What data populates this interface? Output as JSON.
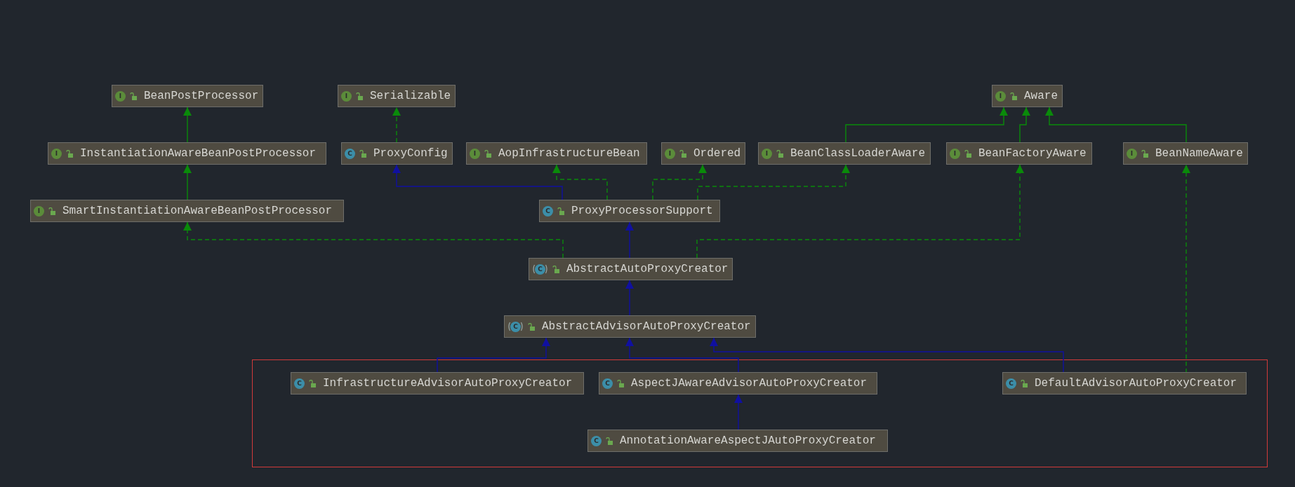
{
  "diagram": {
    "nodes": [
      {
        "name": "BeanPostProcessor",
        "kind": "interface",
        "icon_letter": "I"
      },
      {
        "name": "Serializable",
        "kind": "interface",
        "icon_letter": "I"
      },
      {
        "name": "Aware",
        "kind": "interface",
        "icon_letter": "I"
      },
      {
        "name": "InstantiationAwareBeanPostProcessor",
        "kind": "interface",
        "icon_letter": "I"
      },
      {
        "name": "ProxyConfig",
        "kind": "class",
        "icon_letter": "C"
      },
      {
        "name": "AopInfrastructureBean",
        "kind": "interface",
        "icon_letter": "I"
      },
      {
        "name": "Ordered",
        "kind": "interface",
        "icon_letter": "I"
      },
      {
        "name": "BeanClassLoaderAware",
        "kind": "interface",
        "icon_letter": "I"
      },
      {
        "name": "BeanFactoryAware",
        "kind": "interface",
        "icon_letter": "I"
      },
      {
        "name": "BeanNameAware",
        "kind": "interface",
        "icon_letter": "I"
      },
      {
        "name": "SmartInstantiationAwareBeanPostProcessor",
        "kind": "interface",
        "icon_letter": "I"
      },
      {
        "name": "ProxyProcessorSupport",
        "kind": "class",
        "icon_letter": "C"
      },
      {
        "name": "AbstractAutoProxyCreator",
        "kind": "abstract",
        "icon_letter": "C"
      },
      {
        "name": "AbstractAdvisorAutoProxyCreator",
        "kind": "abstract",
        "icon_letter": "C"
      },
      {
        "name": "InfrastructureAdvisorAutoProxyCreator",
        "kind": "class",
        "icon_letter": "C"
      },
      {
        "name": "AspectJAwareAdvisorAutoProxyCreator",
        "kind": "class",
        "icon_letter": "C"
      },
      {
        "name": "DefaultAdvisorAutoProxyCreator",
        "kind": "class",
        "icon_letter": "C"
      },
      {
        "name": "AnnotationAwareAspectJAutoProxyCreator",
        "kind": "class",
        "icon_letter": "C"
      }
    ],
    "edges": [
      {
        "kind": "interface-extends"
      },
      {
        "kind": "interface-extends"
      },
      {
        "kind": "implements"
      },
      {
        "kind": "class-extends"
      },
      {
        "kind": "implements"
      },
      {
        "kind": "implements"
      },
      {
        "kind": "implements"
      },
      {
        "kind": "interface-extends"
      },
      {
        "kind": "interface-extends"
      },
      {
        "kind": "interface-extends"
      },
      {
        "kind": "class-extends"
      },
      {
        "kind": "implements"
      },
      {
        "kind": "implements"
      },
      {
        "kind": "class-extends"
      },
      {
        "kind": "class-extends"
      },
      {
        "kind": "class-extends"
      },
      {
        "kind": "class-extends"
      },
      {
        "kind": "class-extends"
      },
      {
        "kind": "implements"
      }
    ]
  }
}
